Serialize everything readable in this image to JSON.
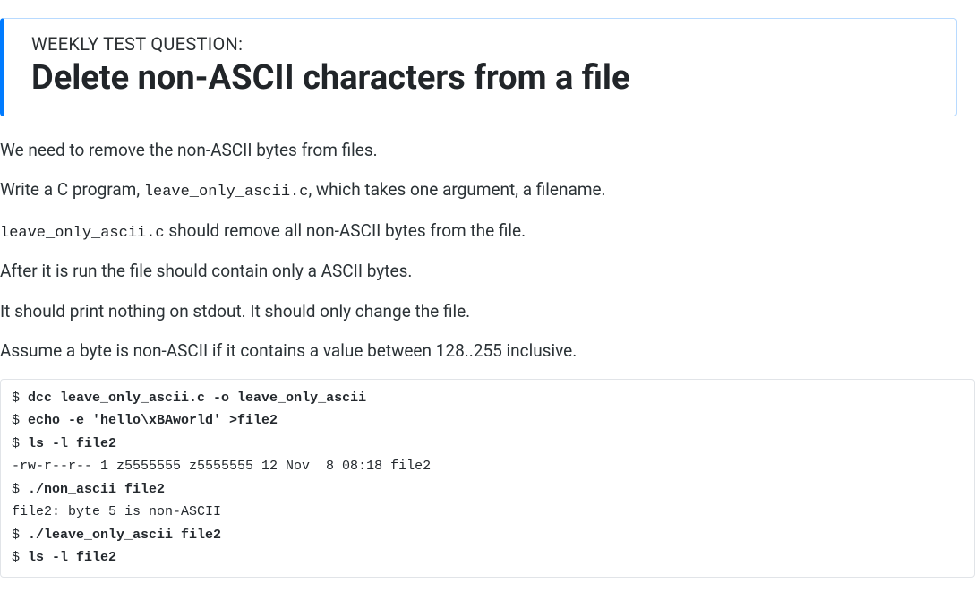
{
  "banner": {
    "kicker": "WEEKLY TEST QUESTION:",
    "title": "Delete non-ASCII characters from a file"
  },
  "paragraphs": {
    "p1": "We need to remove the non-ASCII bytes from files.",
    "p2a": "Write a C program, ",
    "p2_code": "leave_only_ascii.c",
    "p2b": ", which takes one argument, a filename.",
    "p3_code": "leave_only_ascii.c",
    "p3b": " should remove all non-ASCII bytes from the file.",
    "p4": "After it is run the file should contain only a ASCII bytes.",
    "p5": "It should print nothing on stdout. It should only change the file.",
    "p6": "Assume a byte is non-ASCII if it contains a value between 128..255 inclusive."
  },
  "terminal": {
    "prompt": "$ ",
    "lines": [
      {
        "type": "cmd",
        "text": "dcc leave_only_ascii.c -o leave_only_ascii"
      },
      {
        "type": "cmd",
        "text": "echo -e 'hello\\xBAworld' >file2"
      },
      {
        "type": "cmd",
        "text": "ls -l file2"
      },
      {
        "type": "out",
        "text": "-rw-r--r-- 1 z5555555 z5555555 12 Nov  8 08:18 file2"
      },
      {
        "type": "cmd",
        "text": "./non_ascii file2"
      },
      {
        "type": "out",
        "text": "file2: byte 5 is non-ASCII"
      },
      {
        "type": "cmd",
        "text": "./leave_only_ascii file2"
      },
      {
        "type": "cmd",
        "text": "ls -l file2"
      }
    ]
  }
}
